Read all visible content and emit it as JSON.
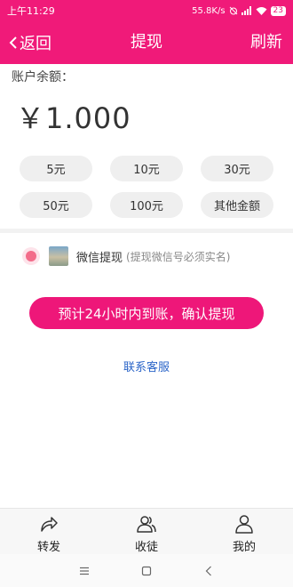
{
  "status_bar": {
    "time": "上午11:29",
    "network_speed": "55.8K/s",
    "battery": "23"
  },
  "nav": {
    "back_label": "返回",
    "title": "提现",
    "refresh_label": "刷新"
  },
  "balance": {
    "label": "账户余额：",
    "amount": "￥1.000"
  },
  "amount_options": [
    "5元",
    "10元",
    "30元",
    "50元",
    "100元",
    "其他金额"
  ],
  "payment": {
    "method": "微信提现",
    "note": "(提现微信号必须实名)",
    "selected": true
  },
  "confirm_button": "预计24小时内到账，确认提现",
  "service_link": "联系客服",
  "tabs": [
    {
      "label": "转发",
      "icon": "share-icon"
    },
    {
      "label": "收徒",
      "icon": "people-icon"
    },
    {
      "label": "我的",
      "icon": "user-icon"
    }
  ],
  "colors": {
    "accent": "#f01a79",
    "link": "#2a64c8"
  }
}
